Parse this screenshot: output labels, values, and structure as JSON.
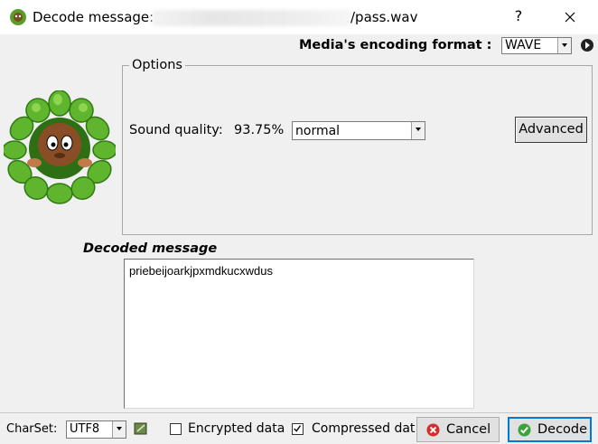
{
  "window": {
    "title_prefix": "Decode message:",
    "title_suffix": "/pass.wav",
    "help_label": "?"
  },
  "encoding": {
    "label": "Media's encoding format :",
    "selected": "WAVE"
  },
  "options": {
    "legend": "Options",
    "sound_quality_label": "Sound quality:",
    "sound_quality_value": "93.75%",
    "quality_selected": "normal",
    "advanced_label": "Advanced"
  },
  "decoded": {
    "label": "Decoded message",
    "text": "priebeijoarkjpxmdkucxwdus"
  },
  "footer": {
    "charset_label": "CharSet:",
    "charset_selected": "UTF8",
    "encrypted_label": "Encrypted data",
    "encrypted_checked": false,
    "compressed_label": "Compressed dat",
    "compressed_checked": true,
    "cancel_label": "Cancel",
    "decode_label": "Decode"
  },
  "colors": {
    "cancel_icon": "#d92b2b",
    "decode_icon": "#3aa33a",
    "focus_border": "#0078d7"
  }
}
